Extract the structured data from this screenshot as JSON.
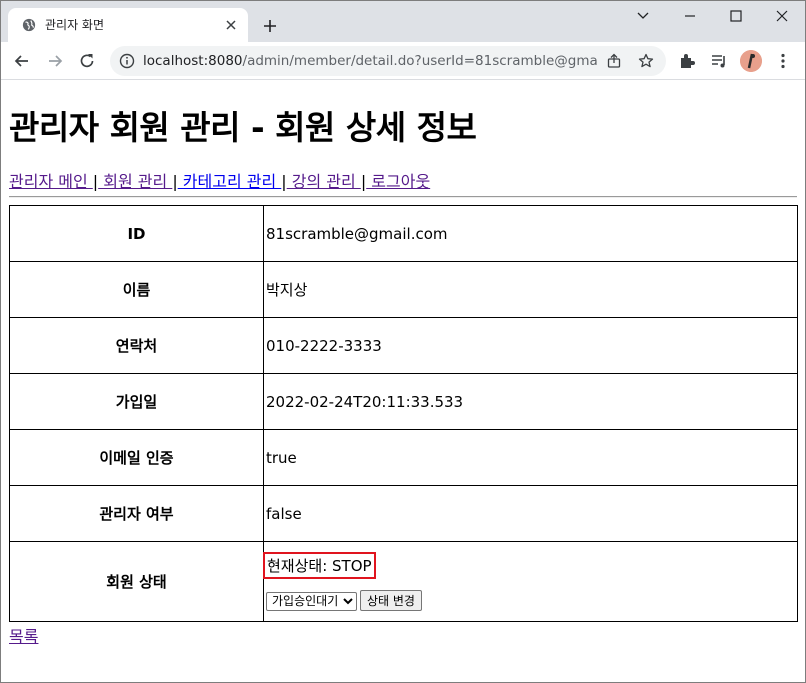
{
  "browser": {
    "tab_title": "관리자 화면",
    "url_host": "localhost:8080",
    "url_path": "/admin/member/detail.do?userId=81scramble@gmail.c..."
  },
  "page": {
    "heading": "관리자 회원 관리 - 회원 상세 정보",
    "nav": [
      {
        "label": "관리자 메인 "
      },
      {
        "label": " 회원 관리 "
      },
      {
        "label": " 카테고리 관리 "
      },
      {
        "label": " 강의 관리 "
      },
      {
        "label": " 로그아웃"
      }
    ],
    "nav_separator": "|",
    "rows": [
      {
        "key": "ID",
        "value": "81scramble@gmail.com"
      },
      {
        "key": "이름",
        "value": "박지상"
      },
      {
        "key": "연락처",
        "value": "010-2222-3333"
      },
      {
        "key": "가입일",
        "value": "2022-02-24T20:11:33.533"
      },
      {
        "key": "이메일 인증",
        "value": "true"
      },
      {
        "key": "관리자 여부",
        "value": "false"
      }
    ],
    "status": {
      "key": "회원 상태",
      "current": "현재상태: STOP",
      "selected_option": "가입승인대기",
      "button_label": "상태 변경"
    },
    "list_link": "목록"
  },
  "colors": {
    "highlight": "#e0141e",
    "link_visited": "#551a8b",
    "link": "#0000ee"
  }
}
